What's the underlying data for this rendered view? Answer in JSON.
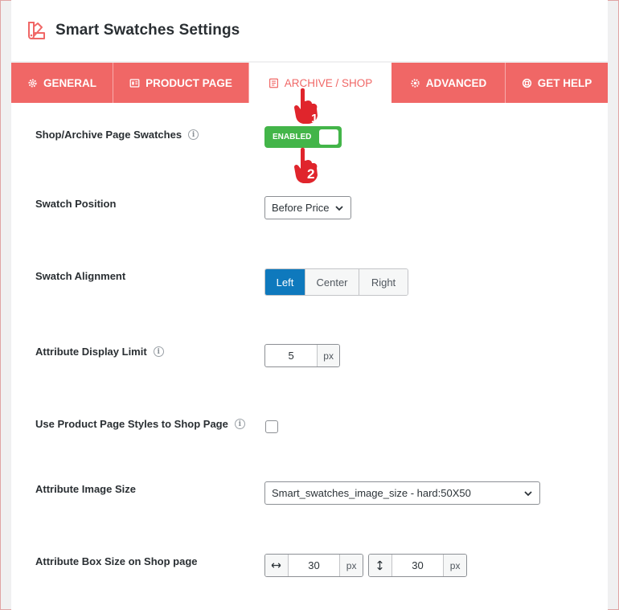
{
  "header": {
    "title": "Smart Swatches Settings",
    "logo_icon": "swatch-palette-icon"
  },
  "tabs": [
    {
      "label": "GENERAL",
      "icon": "gear-icon"
    },
    {
      "label": "PRODUCT PAGE",
      "icon": "product-page-icon"
    },
    {
      "label": "ARCHIVE / SHOP",
      "icon": "archive-icon",
      "active": true
    },
    {
      "label": "ADVANCED",
      "icon": "gears-icon"
    },
    {
      "label": "GET HELP",
      "icon": "lifebuoy-icon"
    }
  ],
  "settings": {
    "shop_swatches": {
      "label": "Shop/Archive Page Swatches",
      "toggle_label": "ENABLED",
      "enabled": true
    },
    "swatch_position": {
      "label": "Swatch Position",
      "value": "Before Price"
    },
    "swatch_alignment": {
      "label": "Swatch Alignment",
      "options": [
        "Left",
        "Center",
        "Right"
      ],
      "selected": "Left"
    },
    "display_limit": {
      "label": "Attribute Display Limit",
      "value": "5",
      "unit": "px"
    },
    "use_product_styles": {
      "label": "Use Product Page Styles to Shop Page",
      "checked": false
    },
    "image_size": {
      "label": "Attribute Image Size",
      "value": "Smart_swatches_image_size - hard:50X50"
    },
    "box_size": {
      "label": "Attribute Box Size on Shop page",
      "width": "30",
      "height": "30",
      "unit": "px"
    }
  },
  "annotations": {
    "step1": "1",
    "step2": "2"
  },
  "colors": {
    "accent": "#f06766",
    "toggle_on": "#43b549",
    "active_segment": "#0e79bd",
    "pointer": "#e0252c"
  }
}
